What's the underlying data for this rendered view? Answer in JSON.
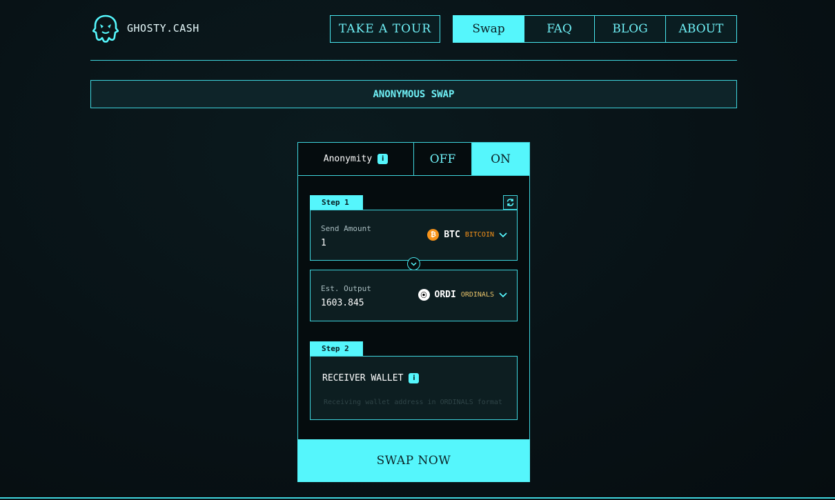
{
  "header": {
    "brand": "GHOSTY.CASH",
    "nav": {
      "tour": "TAKE A TOUR",
      "swap": "Swap",
      "faq": "FAQ",
      "blog": "BLOG",
      "about": "ABOUT"
    }
  },
  "banner": {
    "title": "ANONYMOUS SWAP"
  },
  "anonymity": {
    "label": "Anonymity",
    "info": "i",
    "off": "OFF",
    "on": "ON",
    "selected": "ON"
  },
  "step1": {
    "tab": "Step 1",
    "send": {
      "label": "Send Amount",
      "value": "1",
      "coin_symbol": "BTC",
      "coin_name": "BITCOIN",
      "coin_icon": "bitcoin-icon",
      "coin_color": "#f7931a"
    },
    "output": {
      "label": "Est. Output",
      "value": "1603.845",
      "coin_symbol": "ORDI",
      "coin_name": "ORDINALS",
      "coin_icon": "ordinals-icon",
      "coin_color": "#e9c46a"
    }
  },
  "step2": {
    "tab": "Step 2",
    "wallet_label": "RECEIVER WALLET",
    "info": "i",
    "placeholder": "Receiving wallet address in ORDINALS format"
  },
  "swap_button": "SWAP NOW",
  "colors": {
    "accent": "#55f6fc",
    "border": "#3fd6de",
    "background": "#081216"
  }
}
